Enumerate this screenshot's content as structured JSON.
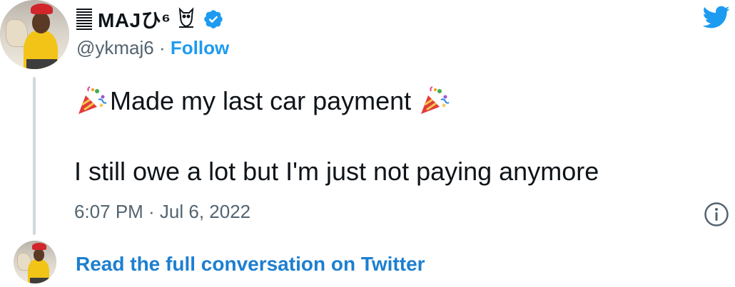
{
  "author": {
    "display_name": "MAJひ⁶",
    "handle": "@ykmaj6",
    "separator": "·",
    "follow_label": "Follow",
    "verified": true
  },
  "tweet": {
    "line1_text": "Made my last car payment",
    "line2_text": "I still owe a lot but I'm just not paying anymore",
    "emoji": "party-popper",
    "timestamp": "6:07 PM · Jul 6, 2022"
  },
  "footer": {
    "read_full_label": "Read the full conversation on Twitter"
  },
  "icons": {
    "brand": "twitter-bird-icon",
    "verified": "verified-badge-icon",
    "info": "info-icon",
    "owl": "owl-icon"
  },
  "colors": {
    "twitter_blue": "#1d9bf0",
    "link_blue": "#1d7fd0",
    "secondary_text": "#536471",
    "thread_line": "#cfd9de"
  }
}
